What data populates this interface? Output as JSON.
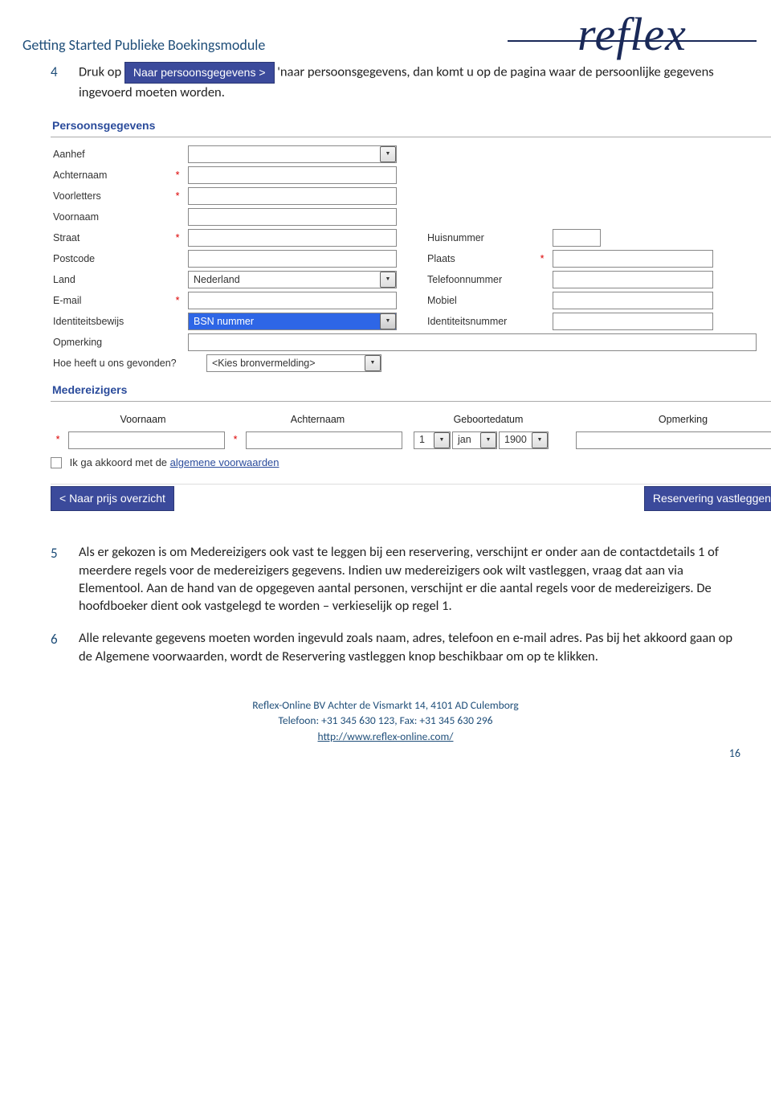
{
  "doc": {
    "title": "Getting Started Publieke Boekingsmodule",
    "logo": "reflex"
  },
  "step4": {
    "prefix": "Druk op ",
    "button": "Naar persoonsgegevens >",
    "suffix": " 'naar persoonsgegevens, dan komt u op de pagina waar de persoonlijke gegevens ingevoerd moeten worden."
  },
  "form": {
    "section1": "Persoonsgegevens",
    "labels": {
      "aanhef": "Aanhef",
      "achternaam": "Achternaam",
      "voorletters": "Voorletters",
      "voornaam": "Voornaam",
      "straat": "Straat",
      "huisnummer": "Huisnummer",
      "postcode": "Postcode",
      "plaats": "Plaats",
      "land": "Land",
      "telefoon": "Telefoonnummer",
      "email": "E-mail",
      "mobiel": "Mobiel",
      "idbewijs": "Identiteitsbewijs",
      "idnummer": "Identiteitsnummer",
      "opmerking": "Opmerking",
      "bron": "Hoe heeft u ons gevonden?"
    },
    "values": {
      "land": "Nederland",
      "idbewijs": "BSN nummer",
      "bron": "<Kies bronvermelding>"
    },
    "section2": "Medereizigers",
    "mede_headers": {
      "c1": "Voornaam",
      "c2": "Achternaam",
      "c3": "Geboortedatum",
      "c4": "Opmerking"
    },
    "mede_date": {
      "day": "1",
      "month": "jan",
      "year": "1900"
    },
    "akkoord_pre": "Ik ga akkoord met de ",
    "akkoord_link": "algemene voorwaarden",
    "nav_prev": "<  Naar prijs overzicht",
    "nav_next": "Reservering vastleggen  >"
  },
  "step5": {
    "text": "Als er gekozen is om Medereizigers ook vast te leggen bij een reservering, verschijnt er onder aan de contactdetails 1 of meerdere regels voor de medereizigers gegevens. Indien uw medereizigers ook wilt vastleggen, vraag dat aan via Elementool. Aan de hand van de opgegeven aantal personen, verschijnt er die aantal regels voor de medereizigers. De hoofdboeker dient ook vastgelegd te worden – verkieselijk op regel 1."
  },
  "step6": {
    "text": "Alle relevante gegevens moeten worden ingevuld zoals naam, adres, telefoon en e-mail adres. Pas bij het akkoord gaan op de Algemene voorwaarden, wordt de Reservering vastleggen knop beschikbaar om op te klikken."
  },
  "footer": {
    "line1": "Reflex-Online BV  Achter de Vismarkt 14, 4101 AD  Culemborg",
    "line2": "Telefoon: +31 345 630 123, Fax: +31 345 630 296",
    "url": "http://www.reflex-online.com/",
    "page": "16"
  }
}
